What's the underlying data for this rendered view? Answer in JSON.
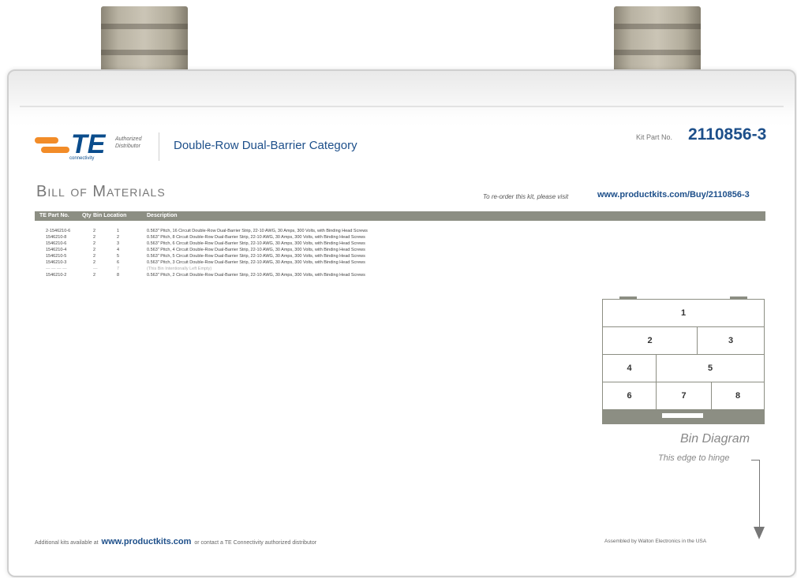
{
  "brand": {
    "logo_text": "TE",
    "logo_sub": "connectivity",
    "authorized_line1": "Authorized",
    "authorized_line2": "Distributor",
    "orange": "#f28c28",
    "blue": "#0a4c8c"
  },
  "header": {
    "category": "Double-Row Dual-Barrier Category",
    "kit_label": "Kit Part No.",
    "kit_number": "2110856-3"
  },
  "bom": {
    "title": "Bill of Materials",
    "reorder_text": "To re-order this kit, please visit",
    "reorder_url": "www.productkits.com/Buy/2110856-3",
    "columns": [
      "TE Part No.",
      "Qty",
      "Bin Location",
      "Description"
    ],
    "rows": [
      {
        "part": "2-1546210-6",
        "qty": "2",
        "bin": "1",
        "desc": "0.563\" Pitch, 16 Circuit Double-Row Dual-Barrier Strip, 22-10 AWG, 30 Amps, 300 Volts, with Binding Head Screws"
      },
      {
        "part": "1546210-8",
        "qty": "2",
        "bin": "2",
        "desc": "0.563\" Pitch, 8 Circuit Double-Row Dual-Barrier Strip, 22-10 AWG, 30 Amps, 300 Volts, with Binding Head Screws"
      },
      {
        "part": "1546210-6",
        "qty": "2",
        "bin": "3",
        "desc": "0.563\" Pitch, 6 Circuit Double-Row Dual-Barrier Strip, 22-10 AWG, 30 Amps, 300 Volts, with Binding Head Screws"
      },
      {
        "part": "1546210-4",
        "qty": "2",
        "bin": "4",
        "desc": "0.563\" Pitch, 4 Circuit Double-Row Dual-Barrier Strip, 22-10 AWG, 30 Amps, 300 Volts, with Binding Head Screws"
      },
      {
        "part": "1546210-5",
        "qty": "2",
        "bin": "5",
        "desc": "0.563\" Pitch, 5 Circuit Double-Row Dual-Barrier Strip, 22-10 AWG, 30 Amps, 300 Volts, with Binding Head Screws"
      },
      {
        "part": "1546210-3",
        "qty": "2",
        "bin": "6",
        "desc": "0.563\" Pitch, 3 Circuit Double-Row Dual-Barrier Strip, 22-10 AWG, 30 Amps, 300 Volts, with Binding Head Screws"
      },
      {
        "part": "— — — —",
        "qty": "—",
        "bin": "7",
        "desc": "(This Bin Intentionally Left Empty)"
      },
      {
        "part": "1546210-2",
        "qty": "2",
        "bin": "8",
        "desc": "0.563\" Pitch, 2 Circuit Double-Row Dual-Barrier Strip, 22-10 AWG, 30 Amps, 300 Volts, with Binding Head Screws"
      }
    ]
  },
  "bin_diagram": {
    "labels": [
      "1",
      "2",
      "3",
      "4",
      "5",
      "6",
      "7",
      "8"
    ],
    "caption": "Bin Diagram",
    "hinge_text": "This edge to hinge"
  },
  "footer": {
    "left_before": "Additional kits available at",
    "url": "www.productkits.com",
    "left_after": "or contact a TE Connectivity authorized distributor",
    "right": "Assembled by Walton Electronics in the USA"
  }
}
